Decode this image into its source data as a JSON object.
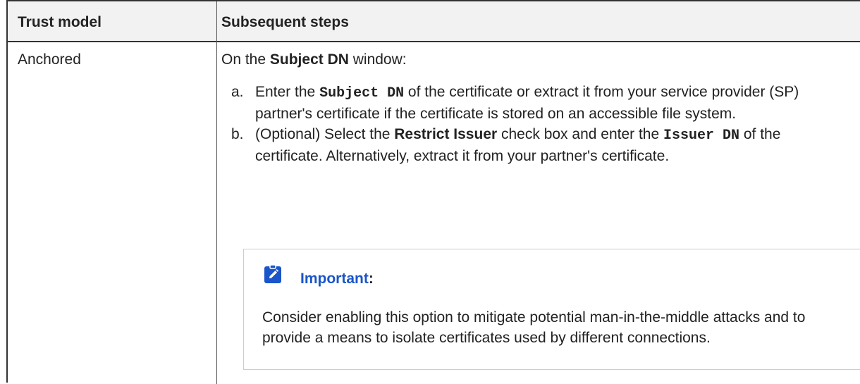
{
  "table": {
    "headers": [
      "Trust model",
      "Subsequent steps"
    ],
    "row": {
      "trust_model": "Anchored",
      "intro": {
        "prefix": "On the ",
        "window_name": "Subject DN",
        "suffix": " window:"
      },
      "steps": [
        {
          "marker": "a.",
          "parts": [
            {
              "text": "Enter the ",
              "style": "normal"
            },
            {
              "text": "Subject DN",
              "style": "mono"
            },
            {
              "text": " of the certificate or extract it from your service provider (SP) partner's certificate if the certificate is stored on an accessible file system.",
              "style": "normal"
            }
          ]
        },
        {
          "marker": "b.",
          "parts": [
            {
              "text": "(Optional) Select the ",
              "style": "normal"
            },
            {
              "text": "Restrict Issuer",
              "style": "bold"
            },
            {
              "text": " check box and enter the ",
              "style": "normal"
            },
            {
              "text": "Issuer DN",
              "style": "mono"
            },
            {
              "text": " of the certificate. Alternatively, extract it from your partner's certificate.",
              "style": "normal"
            }
          ]
        }
      ],
      "note": {
        "icon": "pencil-note-icon",
        "title_link": "Important",
        "title_suffix": ":",
        "body": "Consider enabling this option to mitigate potential man-in-the-middle attacks and to provide a means to isolate certificates used by different connections."
      }
    }
  },
  "colors": {
    "link": "#1a55c9",
    "icon_bg": "#1a55c9",
    "header_bg": "#f2f2f2",
    "border": "#333333"
  }
}
